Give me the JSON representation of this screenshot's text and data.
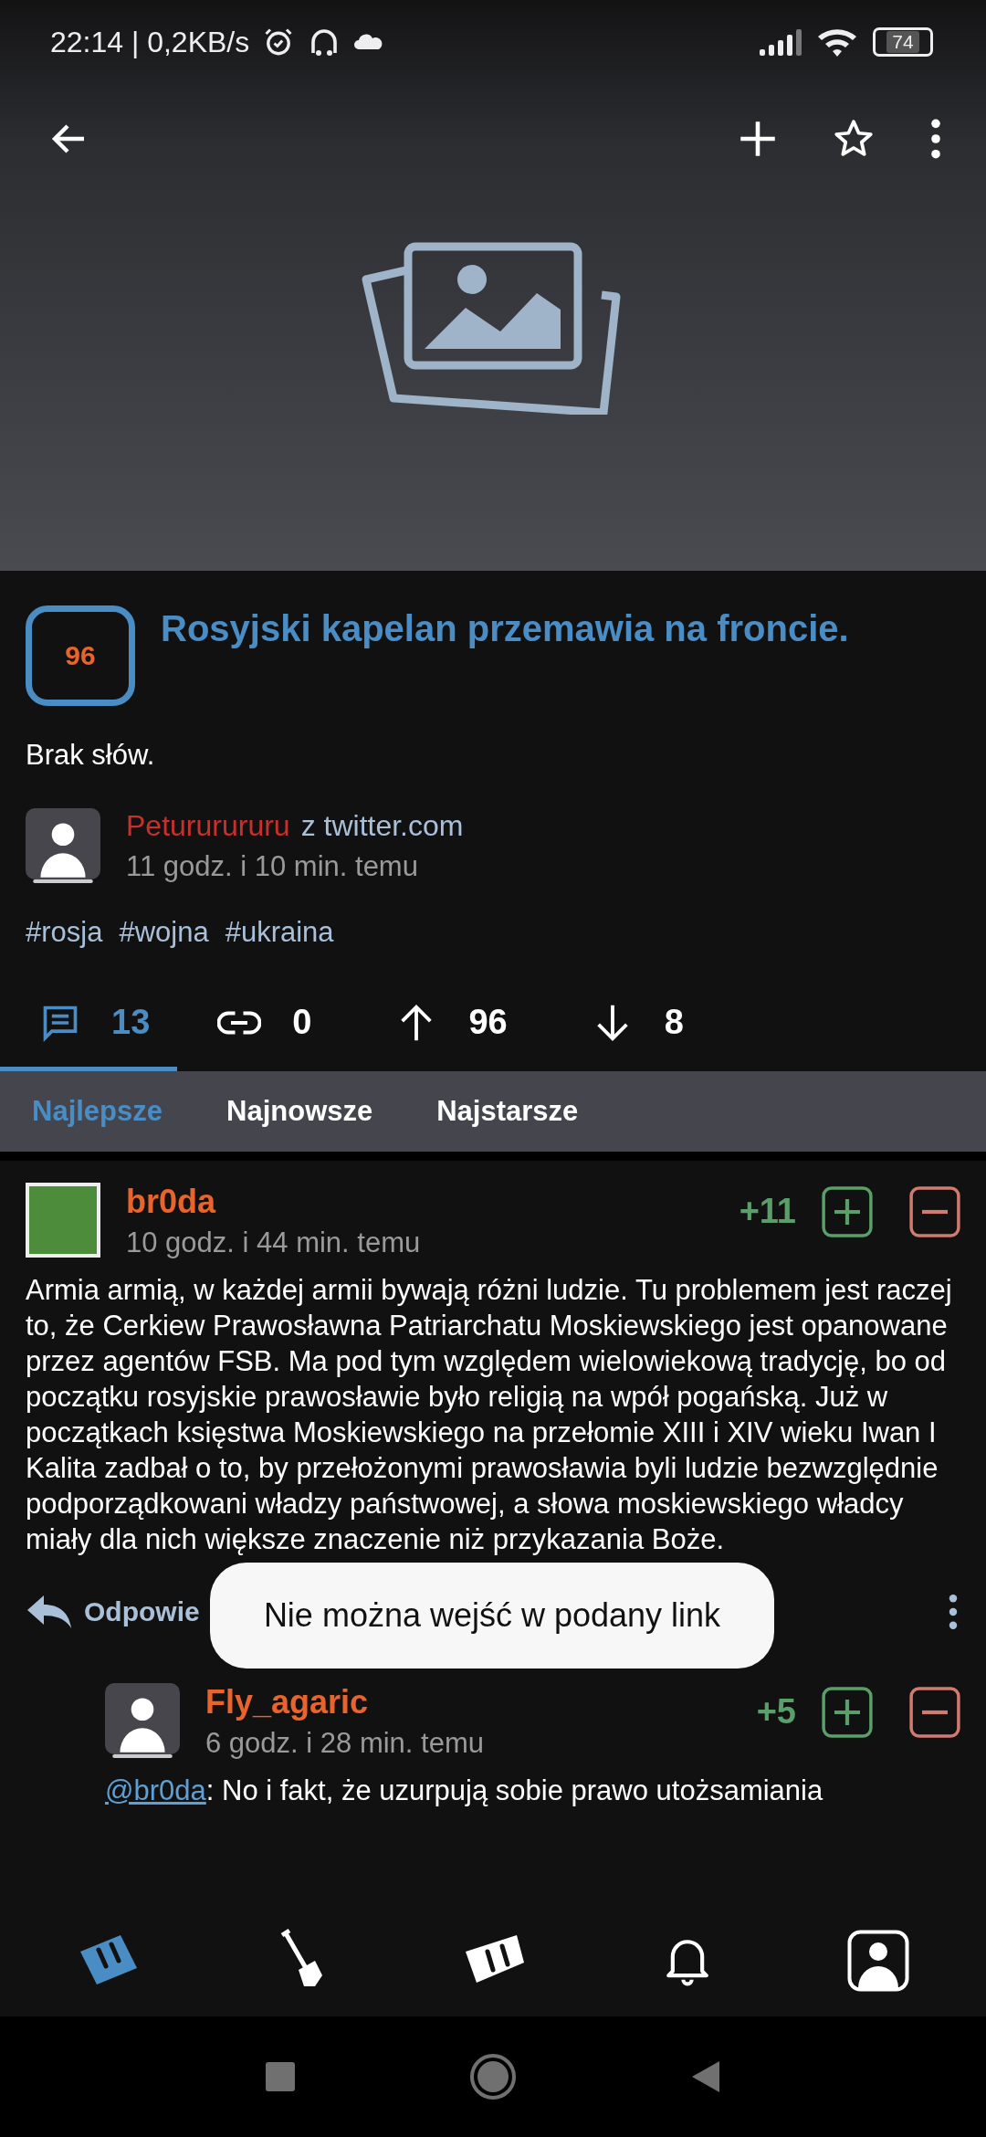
{
  "status_bar": {
    "time_speed": "22:14 | 0,2KB/s",
    "battery": "74"
  },
  "post": {
    "score": "96",
    "title": "Rosyjski kapelan przemawia na froncie.",
    "description": "Brak słów.",
    "author": "Petururururu",
    "source": "z twitter.com",
    "time": "11 godz. i 10 min. temu",
    "tags": [
      "#rosja",
      "#wojna",
      "#ukraina"
    ]
  },
  "stat_tabs": [
    {
      "kind": "comments",
      "label": "13",
      "selected": true
    },
    {
      "kind": "links",
      "label": "0",
      "selected": false
    },
    {
      "kind": "upvotes",
      "label": "96",
      "selected": false
    },
    {
      "kind": "downvotes",
      "label": "8",
      "selected": false
    }
  ],
  "sort_tabs": [
    {
      "label": "Najlepsze",
      "selected": true
    },
    {
      "label": "Najnowsze",
      "selected": false
    },
    {
      "label": "Najstarsze",
      "selected": false
    }
  ],
  "comments": [
    {
      "kind": "picture",
      "name": "br0da",
      "time": "10 godz. i 44 min. temu",
      "score": "+11",
      "body": "Armia armią, w każdej armii bywają różni ludzie. Tu problemem jest raczej to, że Cerkiew Prawosławna Patriarchatu Moskiewskiego jest opanowane przez agentów FSB. Ma pod tym względem wielowiekową tradycję, bo od początku rosyjskie prawosławie było religią na wpół pogańską. Już w początkach księstwa Moskiewskiego na przełomie XIII i XIV wieku Iwan I Kalita zadbał o to, by przełożonymi prawosławia byli ludzie bezwzględnie podporządkowani władzy państwowej, a słowa moskiewskiego władcy miały dla nich większe znaczenie niż przykazania Boże.",
      "reply_label": "Odpowie",
      "children": [
        {
          "kind": "default",
          "name": "Fly_agaric",
          "time": "6 godz. i 28 min. temu",
          "score": "+5",
          "mention": "@br0da",
          "body": ": No i fakt, że uzurpują sobie prawo utożsamiania"
        }
      ]
    }
  ],
  "toast": "Nie można wejść w podany link",
  "bottom_nav": [
    {
      "kind": "home",
      "selected": true
    },
    {
      "kind": "dig",
      "selected": false
    },
    {
      "kind": "micro",
      "selected": false
    },
    {
      "kind": "notifications",
      "selected": false
    },
    {
      "kind": "profile",
      "selected": false
    }
  ]
}
